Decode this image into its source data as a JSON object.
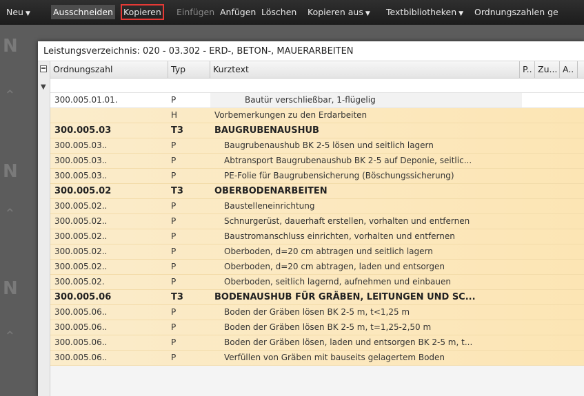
{
  "menu": {
    "items": [
      {
        "label": "Neu",
        "caret": true,
        "state": "normal"
      },
      {
        "label": "Ausschneiden",
        "caret": false,
        "state": "hl"
      },
      {
        "label": "Kopieren",
        "caret": false,
        "state": "sel"
      },
      {
        "label": "Einfügen",
        "caret": false,
        "state": "disabled"
      },
      {
        "label": "Anfügen",
        "caret": false,
        "state": "normal"
      },
      {
        "label": "Löschen",
        "caret": false,
        "state": "normal"
      },
      {
        "label": "Kopieren aus",
        "caret": true,
        "state": "normal"
      },
      {
        "label": "Textbibliotheken",
        "caret": true,
        "state": "normal"
      },
      {
        "label": "Ordnungszahlen ge",
        "caret": false,
        "state": "normal"
      }
    ]
  },
  "panel": {
    "title": "Leistungsverzeichnis: 020 - 03.302 - ERD-, BETON-, MAUERARBEITEN"
  },
  "columns": {
    "oz": "Ordnungszahl",
    "typ": "Typ",
    "kurztext": "Kurztext",
    "p": "P..",
    "zu": "Zu...",
    "a": "A.."
  },
  "rows": [
    {
      "oz": "300.005.01.01.",
      "typ": "P",
      "text": "Bautür verschließbar, 1-flügelig",
      "kind": "first"
    },
    {
      "oz": "",
      "typ": "H",
      "text": "Vorbemerkungen zu den Erdarbeiten",
      "kind": "h"
    },
    {
      "oz": "300.005.03",
      "typ": "T3",
      "text": "BAUGRUBENAUSHUB",
      "kind": "t3"
    },
    {
      "oz": "300.005.03..",
      "typ": "P",
      "text": "Baugrubenaushub BK 2-5 lösen und seitlich lagern",
      "kind": "p"
    },
    {
      "oz": "300.005.03..",
      "typ": "P",
      "text": "Abtransport Baugrubenaushub BK 2-5 auf Deponie, seitlic...",
      "kind": "p"
    },
    {
      "oz": "300.005.03..",
      "typ": "P",
      "text": "PE-Folie für Baugrubensicherung (Böschungssicherung)",
      "kind": "p"
    },
    {
      "oz": "300.005.02",
      "typ": "T3",
      "text": "OBERBODENARBEITEN",
      "kind": "t3"
    },
    {
      "oz": "300.005.02..",
      "typ": "P",
      "text": "Baustelleneinrichtung",
      "kind": "p"
    },
    {
      "oz": "300.005.02..",
      "typ": "P",
      "text": "Schnurgerüst, dauerhaft erstellen, vorhalten und entfernen",
      "kind": "p"
    },
    {
      "oz": "300.005.02..",
      "typ": "P",
      "text": "Baustromanschluss einrichten, vorhalten und entfernen",
      "kind": "p"
    },
    {
      "oz": "300.005.02..",
      "typ": "P",
      "text": "Oberboden, d=20 cm abtragen und seitlich lagern",
      "kind": "p"
    },
    {
      "oz": "300.005.02..",
      "typ": "P",
      "text": "Oberboden, d=20 cm abtragen, laden und entsorgen",
      "kind": "p"
    },
    {
      "oz": "300.005.02.",
      "typ": "P",
      "text": "Oberboden, seitlich lagernd, aufnehmen und einbauen",
      "kind": "p"
    },
    {
      "oz": "300.005.06",
      "typ": "T3",
      "text": "BODENAUSHUB FÜR GRÄBEN, LEITUNGEN UND SC...",
      "kind": "t3"
    },
    {
      "oz": "300.005.06..",
      "typ": "P",
      "text": "Boden der Gräben lösen BK 2-5 m, t<1,25 m",
      "kind": "p"
    },
    {
      "oz": "300.005.06..",
      "typ": "P",
      "text": "Boden der Gräben lösen BK 2-5 m, t=1,25-2,50 m",
      "kind": "p"
    },
    {
      "oz": "300.005.06..",
      "typ": "P",
      "text": "Boden der Gräben lösen, laden und entsorgen BK 2-5 m, t...",
      "kind": "p"
    },
    {
      "oz": "300.005.06..",
      "typ": "P",
      "text": "Verfüllen von Gräben mit bauseits gelagertem Boden",
      "kind": "p"
    }
  ]
}
